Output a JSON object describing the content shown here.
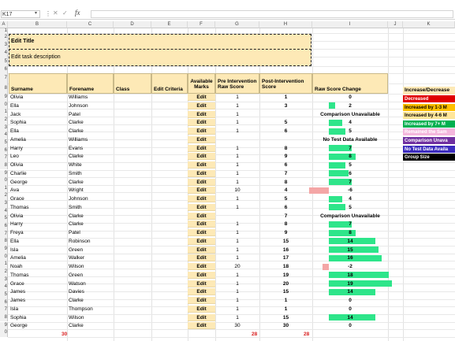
{
  "formula_bar": {
    "name_box": "K17",
    "fx_label": "fx",
    "formula": ""
  },
  "columns": [
    "A",
    "B",
    "C",
    "D",
    "E",
    "F",
    "G",
    "H",
    "I",
    "J",
    "K"
  ],
  "row_numbers": [
    "1",
    "2",
    "3",
    "4",
    "5",
    "6",
    "7",
    "8",
    "9",
    "0",
    "1",
    "2",
    "3",
    "4",
    "5",
    "6",
    "7",
    "8",
    "9",
    "0",
    "1",
    "2",
    "3",
    "4",
    "5",
    "6",
    "7",
    "8",
    "9",
    "0",
    "1",
    "2",
    "3",
    "4",
    "5",
    "6",
    "7",
    "8",
    "9",
    "0",
    "1",
    "2"
  ],
  "title": "Edit Title",
  "description": "Edit task description",
  "headers": {
    "surname": "Surname",
    "forename": "Forename",
    "class": "Class",
    "criteria": "Edit Criteria",
    "marks": "Available Marks",
    "pre": "Pre Intervention Raw Score",
    "post": "Post-Intervention Score",
    "change": "Raw Score Change"
  },
  "edit_label": "Edit",
  "students": [
    {
      "surname": "Olivia",
      "forename": "Williams",
      "pre": "1",
      "post": "1",
      "change": "0",
      "delta": 0
    },
    {
      "surname": "Ella",
      "forename": "Johnson",
      "pre": "1",
      "post": "3",
      "change": "2",
      "delta": 2
    },
    {
      "surname": "Jack",
      "forename": "Patel",
      "pre": "1",
      "post": "",
      "change": "Comparison Unavailable",
      "delta": null
    },
    {
      "surname": "Sophia",
      "forename": "Clarke",
      "pre": "1",
      "post": "5",
      "change": "4",
      "delta": 4
    },
    {
      "surname": "Ella",
      "forename": "Clarke",
      "pre": "1",
      "post": "6",
      "change": "5",
      "delta": 5
    },
    {
      "surname": "Amelia",
      "forename": "Williams",
      "pre": "",
      "post": "",
      "change": "No Test Data Available",
      "delta": null
    },
    {
      "surname": "Harry",
      "forename": "Evans",
      "pre": "1",
      "post": "8",
      "change": "7",
      "delta": 7
    },
    {
      "surname": "Leo",
      "forename": "Clarke",
      "pre": "1",
      "post": "9",
      "change": "8",
      "delta": 8
    },
    {
      "surname": "Olivia",
      "forename": "White",
      "pre": "1",
      "post": "6",
      "change": "5",
      "delta": 5
    },
    {
      "surname": "Charlie",
      "forename": "Smith",
      "pre": "1",
      "post": "7",
      "change": "6",
      "delta": 6
    },
    {
      "surname": "George",
      "forename": "Clarke",
      "pre": "1",
      "post": "8",
      "change": "7",
      "delta": 7
    },
    {
      "surname": "Ava",
      "forename": "Wright",
      "pre": "10",
      "post": "4",
      "change": "-6",
      "delta": -6
    },
    {
      "surname": "Grace",
      "forename": "Johnson",
      "pre": "1",
      "post": "5",
      "change": "4",
      "delta": 4
    },
    {
      "surname": "Thomas",
      "forename": "Smith",
      "pre": "1",
      "post": "6",
      "change": "5",
      "delta": 5
    },
    {
      "surname": "Olivia",
      "forename": "Clarke",
      "pre": "",
      "post": "7",
      "change": "Comparison Unavailable",
      "delta": null
    },
    {
      "surname": "Harry",
      "forename": "Clarke",
      "pre": "1",
      "post": "8",
      "change": "7",
      "delta": 7
    },
    {
      "surname": "Freya",
      "forename": "Patel",
      "pre": "1",
      "post": "9",
      "change": "8",
      "delta": 8
    },
    {
      "surname": "Ella",
      "forename": "Robinson",
      "pre": "1",
      "post": "15",
      "change": "14",
      "delta": 14
    },
    {
      "surname": "Isla",
      "forename": "Green",
      "pre": "1",
      "post": "16",
      "change": "15",
      "delta": 15
    },
    {
      "surname": "Amelia",
      "forename": "Walker",
      "pre": "1",
      "post": "17",
      "change": "16",
      "delta": 16
    },
    {
      "surname": "Noah",
      "forename": "Wilson",
      "pre": "20",
      "post": "18",
      "change": "-2",
      "delta": -2
    },
    {
      "surname": "Thomas",
      "forename": "Green",
      "pre": "1",
      "post": "19",
      "change": "18",
      "delta": 18
    },
    {
      "surname": "Grace",
      "forename": "Watson",
      "pre": "1",
      "post": "20",
      "change": "19",
      "delta": 19
    },
    {
      "surname": "James",
      "forename": "Davies",
      "pre": "1",
      "post": "15",
      "change": "14",
      "delta": 14
    },
    {
      "surname": "James",
      "forename": "Clarke",
      "pre": "1",
      "post": "1",
      "change": "0",
      "delta": 0
    },
    {
      "surname": "Isla",
      "forename": "Thompson",
      "pre": "1",
      "post": "1",
      "change": "0",
      "delta": 0
    },
    {
      "surname": "Sophia",
      "forename": "Wilson",
      "pre": "1",
      "post": "15",
      "change": "14",
      "delta": 14
    },
    {
      "surname": "George",
      "forename": "Clarke",
      "pre": "30",
      "post": "30",
      "change": "0",
      "delta": 0
    }
  ],
  "totals": {
    "marks": "30",
    "pre": "28",
    "post": "28"
  },
  "legend": {
    "header": "Increase/Decrease",
    "items": [
      {
        "label": "Decreased",
        "bg": "#e00000",
        "fg": "#ffffff"
      },
      {
        "label": "Increased by 1-3 M",
        "bg": "#ffc000",
        "fg": "#000000"
      },
      {
        "label": "Increased by 4-6 M",
        "bg": "#ffe699",
        "fg": "#000000"
      },
      {
        "label": "Increased by 7+ M",
        "bg": "#00b050",
        "fg": "#ffffff"
      },
      {
        "label": "Remained the Sam",
        "bg": "#f4b6dc",
        "fg": "#ffffff"
      },
      {
        "label": "Comparison Unava",
        "bg": "#7030a0",
        "fg": "#ffffff"
      },
      {
        "label": "No Test Data Availa",
        "bg": "#3c2cbe",
        "fg": "#ffffff"
      },
      {
        "label": "Group Size",
        "bg": "#000000",
        "fg": "#ffffff"
      }
    ]
  },
  "colors": {
    "header_fill": "#fde9b6",
    "positive_bar": "#2ee58a",
    "negative_bar": "#f4a6a6",
    "total_text": "#d81b1b"
  }
}
